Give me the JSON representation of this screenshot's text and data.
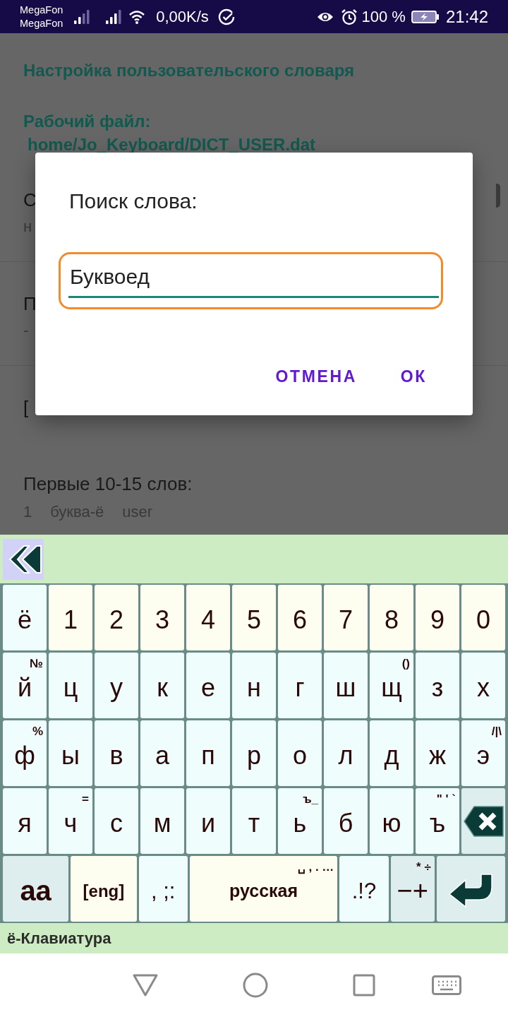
{
  "status_bar": {
    "carriers": [
      "MegaFon",
      "MegaFon"
    ],
    "net_speed": "0,00K/s",
    "battery": "100 %",
    "time": "21:42"
  },
  "screen": {
    "title": "Настройка пользовательского словаря",
    "file_label": "Рабочий файл:",
    "file_path": "home/Jo_Keyboard/DICT_USER.dat",
    "settings": [
      {
        "title": "С",
        "summary": "н",
        "button": true
      },
      {
        "title": "П",
        "summary": "-",
        "button": false
      },
      {
        "title": "[",
        "button": false
      }
    ],
    "list_title": "Первые 10-15 слов:",
    "words": [
      {
        "count": "1",
        "word": "буква-ё",
        "source": "user"
      }
    ]
  },
  "dialog": {
    "title": "Поиск слова:",
    "field": {
      "value": "Буквоед",
      "focused": true,
      "highlighted": true
    },
    "buttons": [
      "ОТМЕНА",
      "ОК"
    ]
  },
  "keyboard": {
    "rows": [
      [
        {
          "label": "ё",
          "kind": "letter"
        },
        {
          "label": "1",
          "kind": "digit"
        },
        {
          "label": "2",
          "kind": "digit"
        },
        {
          "label": "3",
          "kind": "digit"
        },
        {
          "label": "4",
          "kind": "digit"
        },
        {
          "label": "5",
          "kind": "digit"
        },
        {
          "label": "6",
          "kind": "digit"
        },
        {
          "label": "7",
          "kind": "digit"
        },
        {
          "label": "8",
          "kind": "digit"
        },
        {
          "label": "9",
          "kind": "digit"
        },
        {
          "label": "0",
          "kind": "digit"
        }
      ],
      [
        {
          "label": "й",
          "hint": "№",
          "kind": "letter"
        },
        {
          "label": "ц",
          "kind": "letter"
        },
        {
          "label": "у",
          "kind": "letter"
        },
        {
          "label": "к",
          "kind": "letter"
        },
        {
          "label": "е",
          "kind": "letter"
        },
        {
          "label": "н",
          "kind": "letter"
        },
        {
          "label": "г",
          "kind": "letter"
        },
        {
          "label": "ш",
          "kind": "letter"
        },
        {
          "label": "щ",
          "hint": "()",
          "kind": "letter"
        },
        {
          "label": "з",
          "kind": "letter"
        },
        {
          "label": "х",
          "kind": "letter"
        }
      ],
      [
        {
          "label": "ф",
          "hint": "%",
          "kind": "letter"
        },
        {
          "label": "ы",
          "kind": "letter"
        },
        {
          "label": "в",
          "kind": "letter"
        },
        {
          "label": "а",
          "kind": "letter"
        },
        {
          "label": "п",
          "kind": "letter"
        },
        {
          "label": "р",
          "kind": "letter"
        },
        {
          "label": "о",
          "kind": "letter"
        },
        {
          "label": "л",
          "kind": "letter"
        },
        {
          "label": "д",
          "kind": "letter"
        },
        {
          "label": "ж",
          "kind": "letter"
        },
        {
          "label": "э",
          "hint": "/|\\",
          "kind": "letter"
        }
      ],
      [
        {
          "label": "я",
          "kind": "letter"
        },
        {
          "label": "ч",
          "hint": "=",
          "kind": "letter"
        },
        {
          "label": "с",
          "kind": "letter"
        },
        {
          "label": "м",
          "kind": "letter"
        },
        {
          "label": "и",
          "kind": "letter"
        },
        {
          "label": "т",
          "kind": "letter"
        },
        {
          "label": "ь",
          "hint": "ъ_",
          "kind": "letter"
        },
        {
          "label": "б",
          "kind": "letter"
        },
        {
          "label": "ю",
          "kind": "letter"
        },
        {
          "label": "ъ",
          "hint": "\" ' `",
          "kind": "letter"
        },
        {
          "kind": "backspace"
        }
      ]
    ],
    "bottom_row": [
      {
        "label": "aa",
        "kind": "shift"
      },
      {
        "label": "[eng]",
        "kind": "lang"
      },
      {
        "label": ", ;:",
        "kind": "punct"
      },
      {
        "label": "русская",
        "hint": "␣ , . …",
        "kind": "space"
      },
      {
        "label": ".!?",
        "kind": "punct"
      },
      {
        "label": "−+",
        "hint": "* ÷",
        "kind": "ops"
      },
      {
        "kind": "enter"
      }
    ],
    "title": "ё-Клавиатура"
  }
}
